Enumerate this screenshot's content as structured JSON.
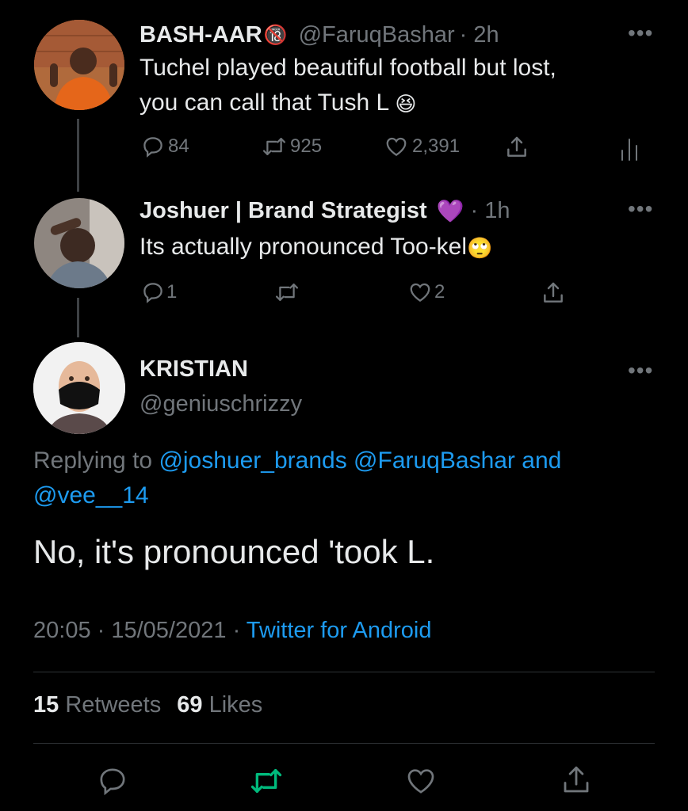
{
  "tweets": [
    {
      "display_name": "BASH-AAR",
      "badge": "🔞",
      "handle": "@FaruqBashar",
      "time": "· 2h",
      "text_line1": "Tuchel played beautiful football but lost,",
      "text_line2": "you can call that Tush L",
      "emoji": "😆",
      "replies": "84",
      "retweets": "925",
      "likes": "2,391"
    },
    {
      "display_name": "Joshuer | Brand Strategist",
      "badge": "💜",
      "time": "· 1h",
      "text": "Its actually pronounced Too-kel",
      "emoji": "🙄",
      "replies": "1",
      "retweets": "",
      "likes": "2"
    }
  ],
  "main_tweet": {
    "display_name": "KRISTIAN",
    "handle": "@geniuschrizzy",
    "replying_label": "Replying to",
    "replying_user1": "@joshuer_brands",
    "replying_user2": "@FaruqBashar",
    "replying_and": "and",
    "replying_user3": "@vee__14",
    "text": "No, it's pronounced 'took L.",
    "time": "20:05",
    "date": "15/05/2021",
    "source": "Twitter for Android",
    "retweets_count": "15",
    "retweets_label": "Retweets",
    "likes_count": "69",
    "likes_label": "Likes"
  },
  "icons": {
    "more": "more-horizontal-icon",
    "reply": "reply-icon",
    "retweet": "retweet-icon",
    "like": "heart-icon",
    "share": "share-icon",
    "analytics": "analytics-icon"
  },
  "colors": {
    "background": "#000000",
    "text": "#e7e9ea",
    "muted": "#71767b",
    "link": "#1d9bf0",
    "retweet_active": "#00ba7c",
    "thread_line": "#3e4144"
  }
}
